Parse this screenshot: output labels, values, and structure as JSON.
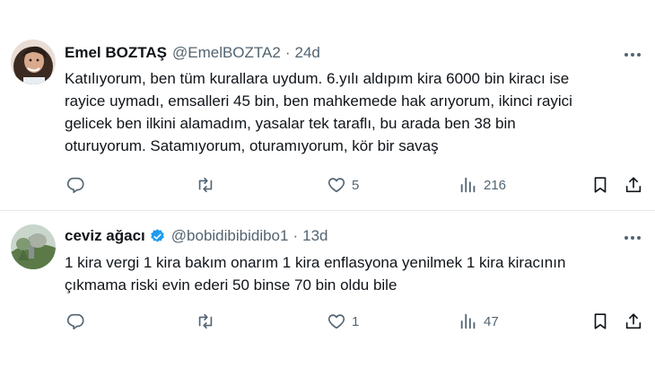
{
  "tweets": [
    {
      "name": "Emel BOZTAŞ",
      "handle": "@EmelBOZTA2",
      "time": "24d",
      "lines": [
        "Katılıyorum, ben tüm kurallara uydum. 6.yılı aldıpım kira 6000 bin kiracı ise",
        "rayice uymadı, emsalleri 45 bin, ben mahkemede hak arıyorum, ikinci rayici",
        "gelicek ben ilkini alamadım, yasalar tek taraflı, bu arada ben 38 bin",
        "oturuyorum. Satamıyorum, oturamıyorum, kör bir savaş"
      ],
      "likes": "5",
      "views": "216",
      "verified": false
    },
    {
      "name": "ceviz ağacı",
      "handle": "@bobidibibidibo1",
      "time": "13d",
      "lines": [
        "1 kira vergi 1 kira bakım onarım 1 kira enflasyona yenilmek 1 kira kiracının",
        "çıkmama riski evin ederi 50 binse 70 bin oldu bile"
      ],
      "likes": "1",
      "views": "47",
      "verified": true
    }
  ],
  "icons": {
    "reply": "reply-icon",
    "retweet": "retweet-icon",
    "like": "heart-icon",
    "views": "views-icon",
    "bookmark": "bookmark-icon",
    "share": "share-icon",
    "more": "more-icon"
  },
  "colors": {
    "text": "#0f1419",
    "secondary": "#536471",
    "verified": "#1d9bf0",
    "divider": "#e6e9eb"
  }
}
